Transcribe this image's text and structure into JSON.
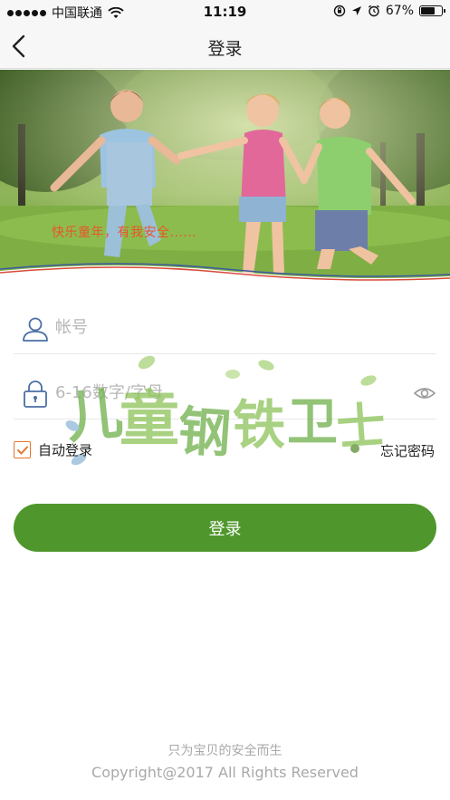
{
  "status_bar": {
    "carrier": "中国联通",
    "time": "11:19",
    "battery": "67%",
    "battery_level": 0.67,
    "icons": [
      "signal-dots",
      "wifi-icon",
      "orientation-lock-icon",
      "location-arrow-icon",
      "alarm-icon",
      "battery-icon"
    ]
  },
  "nav": {
    "title": "登录",
    "back_icon": "chevron-left-icon"
  },
  "banner": {
    "slogan": "快乐童年，有我安全......",
    "image": "children-running-in-park"
  },
  "form": {
    "account": {
      "placeholder": "帐号",
      "value": "",
      "icon": "user-icon"
    },
    "password": {
      "placeholder": "6-16数字/字母",
      "value": "",
      "icon": "lock-icon",
      "toggle_icon": "eye-icon"
    },
    "remember_label": "自动登录",
    "remember_checked": true,
    "forgot_label": "忘记密码",
    "submit_label": "登录"
  },
  "logo": {
    "text": "儿童钢铁卫士"
  },
  "footer": {
    "slogan": "只为宝贝的安全而生",
    "copyright": "Copyright@2017 All Rights Reserved"
  },
  "colors": {
    "primary_green": "#4f972c",
    "accent_orange": "#e8742c",
    "slogan_red": "#e8552b",
    "icon_blue": "#4a6fa5",
    "hint_gray": "#b7b7b7"
  }
}
